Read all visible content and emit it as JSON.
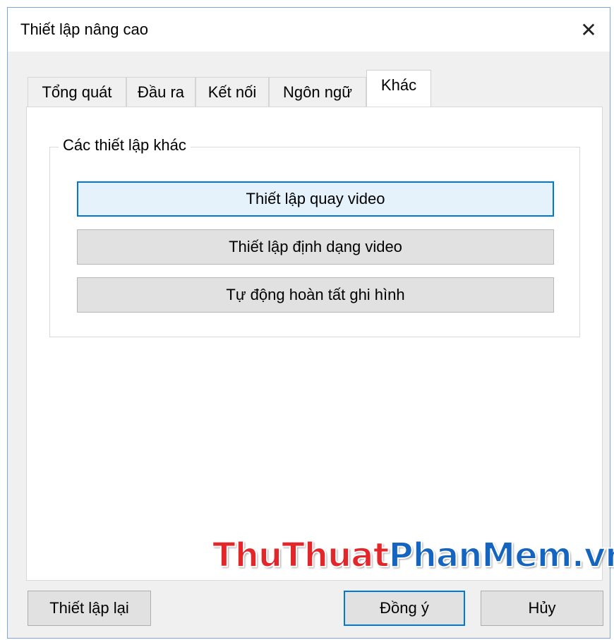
{
  "window": {
    "title": "Thiết lập nâng cao"
  },
  "tabs": [
    {
      "label": "Tổng quát"
    },
    {
      "label": "Đầu ra"
    },
    {
      "label": "Kết nối"
    },
    {
      "label": "Ngôn ngữ"
    },
    {
      "label": "Khác",
      "active": true
    }
  ],
  "group": {
    "label": "Các thiết lập khác",
    "buttons": [
      {
        "label": "Thiết lập quay video"
      },
      {
        "label": "Thiết lập định dạng video"
      },
      {
        "label": "Tự động hoàn tất ghi hình"
      }
    ]
  },
  "watermark": {
    "part1": "ThuThuat",
    "part2": "PhanMem.vn"
  },
  "footer": {
    "reset_label": "Thiết lập lại",
    "ok_label": "Đồng ý",
    "cancel_label": "Hủy"
  },
  "colors": {
    "accent": "#0078d7",
    "watermark_red": "#e2262a",
    "watermark_blue": "#1565c0"
  },
  "icons": {
    "close": "close-icon"
  }
}
